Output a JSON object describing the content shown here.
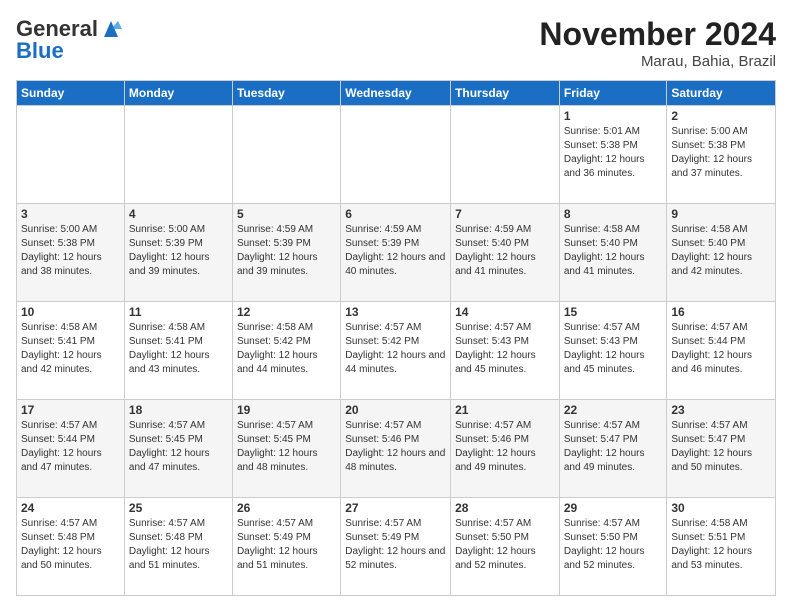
{
  "header": {
    "logo_line1": "General",
    "logo_line2": "Blue",
    "month_title": "November 2024",
    "location": "Marau, Bahia, Brazil"
  },
  "days_of_week": [
    "Sunday",
    "Monday",
    "Tuesday",
    "Wednesday",
    "Thursday",
    "Friday",
    "Saturday"
  ],
  "weeks": [
    [
      {
        "day": "",
        "info": ""
      },
      {
        "day": "",
        "info": ""
      },
      {
        "day": "",
        "info": ""
      },
      {
        "day": "",
        "info": ""
      },
      {
        "day": "",
        "info": ""
      },
      {
        "day": "1",
        "info": "Sunrise: 5:01 AM\nSunset: 5:38 PM\nDaylight: 12 hours and 36 minutes."
      },
      {
        "day": "2",
        "info": "Sunrise: 5:00 AM\nSunset: 5:38 PM\nDaylight: 12 hours and 37 minutes."
      }
    ],
    [
      {
        "day": "3",
        "info": "Sunrise: 5:00 AM\nSunset: 5:38 PM\nDaylight: 12 hours and 38 minutes."
      },
      {
        "day": "4",
        "info": "Sunrise: 5:00 AM\nSunset: 5:39 PM\nDaylight: 12 hours and 39 minutes."
      },
      {
        "day": "5",
        "info": "Sunrise: 4:59 AM\nSunset: 5:39 PM\nDaylight: 12 hours and 39 minutes."
      },
      {
        "day": "6",
        "info": "Sunrise: 4:59 AM\nSunset: 5:39 PM\nDaylight: 12 hours and 40 minutes."
      },
      {
        "day": "7",
        "info": "Sunrise: 4:59 AM\nSunset: 5:40 PM\nDaylight: 12 hours and 41 minutes."
      },
      {
        "day": "8",
        "info": "Sunrise: 4:58 AM\nSunset: 5:40 PM\nDaylight: 12 hours and 41 minutes."
      },
      {
        "day": "9",
        "info": "Sunrise: 4:58 AM\nSunset: 5:40 PM\nDaylight: 12 hours and 42 minutes."
      }
    ],
    [
      {
        "day": "10",
        "info": "Sunrise: 4:58 AM\nSunset: 5:41 PM\nDaylight: 12 hours and 42 minutes."
      },
      {
        "day": "11",
        "info": "Sunrise: 4:58 AM\nSunset: 5:41 PM\nDaylight: 12 hours and 43 minutes."
      },
      {
        "day": "12",
        "info": "Sunrise: 4:58 AM\nSunset: 5:42 PM\nDaylight: 12 hours and 44 minutes."
      },
      {
        "day": "13",
        "info": "Sunrise: 4:57 AM\nSunset: 5:42 PM\nDaylight: 12 hours and 44 minutes."
      },
      {
        "day": "14",
        "info": "Sunrise: 4:57 AM\nSunset: 5:43 PM\nDaylight: 12 hours and 45 minutes."
      },
      {
        "day": "15",
        "info": "Sunrise: 4:57 AM\nSunset: 5:43 PM\nDaylight: 12 hours and 45 minutes."
      },
      {
        "day": "16",
        "info": "Sunrise: 4:57 AM\nSunset: 5:44 PM\nDaylight: 12 hours and 46 minutes."
      }
    ],
    [
      {
        "day": "17",
        "info": "Sunrise: 4:57 AM\nSunset: 5:44 PM\nDaylight: 12 hours and 47 minutes."
      },
      {
        "day": "18",
        "info": "Sunrise: 4:57 AM\nSunset: 5:45 PM\nDaylight: 12 hours and 47 minutes."
      },
      {
        "day": "19",
        "info": "Sunrise: 4:57 AM\nSunset: 5:45 PM\nDaylight: 12 hours and 48 minutes."
      },
      {
        "day": "20",
        "info": "Sunrise: 4:57 AM\nSunset: 5:46 PM\nDaylight: 12 hours and 48 minutes."
      },
      {
        "day": "21",
        "info": "Sunrise: 4:57 AM\nSunset: 5:46 PM\nDaylight: 12 hours and 49 minutes."
      },
      {
        "day": "22",
        "info": "Sunrise: 4:57 AM\nSunset: 5:47 PM\nDaylight: 12 hours and 49 minutes."
      },
      {
        "day": "23",
        "info": "Sunrise: 4:57 AM\nSunset: 5:47 PM\nDaylight: 12 hours and 50 minutes."
      }
    ],
    [
      {
        "day": "24",
        "info": "Sunrise: 4:57 AM\nSunset: 5:48 PM\nDaylight: 12 hours and 50 minutes."
      },
      {
        "day": "25",
        "info": "Sunrise: 4:57 AM\nSunset: 5:48 PM\nDaylight: 12 hours and 51 minutes."
      },
      {
        "day": "26",
        "info": "Sunrise: 4:57 AM\nSunset: 5:49 PM\nDaylight: 12 hours and 51 minutes."
      },
      {
        "day": "27",
        "info": "Sunrise: 4:57 AM\nSunset: 5:49 PM\nDaylight: 12 hours and 52 minutes."
      },
      {
        "day": "28",
        "info": "Sunrise: 4:57 AM\nSunset: 5:50 PM\nDaylight: 12 hours and 52 minutes."
      },
      {
        "day": "29",
        "info": "Sunrise: 4:57 AM\nSunset: 5:50 PM\nDaylight: 12 hours and 52 minutes."
      },
      {
        "day": "30",
        "info": "Sunrise: 4:58 AM\nSunset: 5:51 PM\nDaylight: 12 hours and 53 minutes."
      }
    ]
  ]
}
